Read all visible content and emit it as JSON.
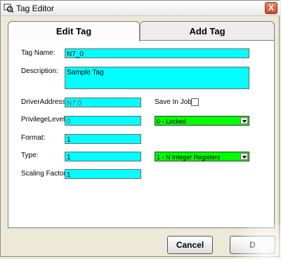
{
  "window": {
    "title": "Tag Editor",
    "close_label": "X"
  },
  "tabs": {
    "edit": "Edit Tag",
    "add": "Add Tag"
  },
  "form": {
    "tag_name": {
      "label": "Tag Name:",
      "value": "N7_0"
    },
    "description": {
      "label": "Description:",
      "value": "Sample Tag"
    },
    "driver_address": {
      "label": "DriverAddress:",
      "value": "N7:0"
    },
    "save_in_job": {
      "label": "Save In Job:",
      "checked": false
    },
    "privilege_level": {
      "label": "PrivilegeLevel:",
      "value": "0",
      "selected": "0 - Locked"
    },
    "format": {
      "label": "Format:",
      "value": "1"
    },
    "type": {
      "label": "Type:",
      "value": "1",
      "selected": "1 - N Integer Registers"
    },
    "scaling_factor": {
      "label": "Scaling Factor:",
      "value": "1"
    }
  },
  "buttons": {
    "cancel": "Cancel",
    "done": "D"
  },
  "colors": {
    "field": "#00ffff",
    "select": "#00ff00",
    "close": "#c94a2b"
  },
  "icons": {
    "app": "tag-editor-app-icon",
    "close": "close-icon",
    "dropdown": "chevron-down-icon"
  }
}
